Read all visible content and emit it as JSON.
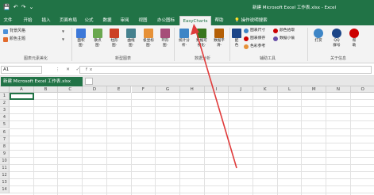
{
  "window": {
    "title": "新建 Microsoft Excel 工作表.xlsx  -  Excel",
    "qat": {
      "save_icon": "💾",
      "undo_icon": "↶",
      "redo_icon": "↷",
      "customize_icon": "⌄"
    }
  },
  "tabs": [
    {
      "label": "文件"
    },
    {
      "label": "开始"
    },
    {
      "label": "插入"
    },
    {
      "label": "页面布局"
    },
    {
      "label": "公式"
    },
    {
      "label": "数据"
    },
    {
      "label": "审阅"
    },
    {
      "label": "视图"
    },
    {
      "label": "办公图标"
    },
    {
      "label": "EasyCharts",
      "active": true
    },
    {
      "label": "帮助"
    }
  ],
  "tell_me": "操作说明搜索",
  "ribbon": {
    "groups": {
      "chart_beautify": "图表元素美化",
      "new_charts": "新型图表",
      "data_analysis": "数据分析",
      "aux_tools": "辅助工具",
      "about": "关于信息"
    },
    "combos": [
      {
        "label": "背景风格",
        "color": "#4a90d9"
      },
      {
        "label": "颜色主题",
        "color": "#e26a2c"
      }
    ],
    "chart_buttons": [
      {
        "label": "面积\n图·",
        "color": "#3c78d8",
        "icon": "area-chart-icon"
      },
      {
        "label": "散点\n图·",
        "color": "#6aa84f",
        "icon": "scatter-chart-icon"
      },
      {
        "label": "柱形\n图·",
        "color": "#cc4125",
        "icon": "column-chart-icon"
      },
      {
        "label": "曲线\n图·",
        "color": "#45818e",
        "icon": "curve-chart-icon"
      },
      {
        "label": "极坐标\n图·",
        "color": "#e69138",
        "icon": "polar-chart-icon"
      },
      {
        "label": "环形\n图·",
        "color": "#a64d79",
        "icon": "ring-chart-icon"
      }
    ],
    "analysis_buttons": [
      {
        "label": "统计分\n析·",
        "color": "#3d85c6",
        "icon": "statistics-icon"
      },
      {
        "label": "数据可\n视化·",
        "color": "#38761d",
        "icon": "visualize-icon"
      },
      {
        "label": "数据平\n滑·",
        "color": "#b45f06",
        "icon": "smooth-icon"
      }
    ],
    "aux": {
      "big_button": {
        "label": "配\n色",
        "color": "#1c4587",
        "icon": "palette-icon"
      },
      "items": [
        {
          "label": "图表尺寸",
          "color": "#3d85c6",
          "icon": "chart-size-icon"
        },
        {
          "label": "颜色拾取",
          "color": "#cc0000",
          "icon": "color-picker-icon"
        },
        {
          "label": "图表保存",
          "color": "#cc0000",
          "icon": "chart-save-icon"
        },
        {
          "label": "数据小偷",
          "color": "#674ea7",
          "icon": "data-thief-icon"
        },
        {
          "label": "色彩参考",
          "color": "#e69138",
          "icon": "color-reference-icon"
        }
      ]
    },
    "about_buttons": [
      {
        "label": "打赏",
        "color": "#3d85c6",
        "icon": "donate-icon"
      },
      {
        "label": "QQ\n群号",
        "color": "#1c4587",
        "icon": "qq-group-icon"
      },
      {
        "label": "帮\n助",
        "color": "#cc0000",
        "icon": "help-icon"
      }
    ]
  },
  "formula_bar": {
    "name_box": "A1",
    "buttons": "⋮ ✕ ✓ fx",
    "value": ""
  },
  "workbook_tab": {
    "label": "新建 Microsoft Excel 工作表.xlsx"
  },
  "sheet": {
    "columns": [
      "A",
      "B",
      "C",
      "D",
      "E",
      "F",
      "G",
      "H",
      "I",
      "J",
      "K",
      "L",
      "M",
      "N",
      "O"
    ],
    "rows": [
      "1",
      "2",
      "3",
      "4",
      "5",
      "6",
      "7",
      "8",
      "9",
      "10",
      "11",
      "12",
      "13",
      "14"
    ],
    "active_cell": "A1"
  },
  "accent_color": "#217346",
  "annotation_color": "#e03b3b"
}
